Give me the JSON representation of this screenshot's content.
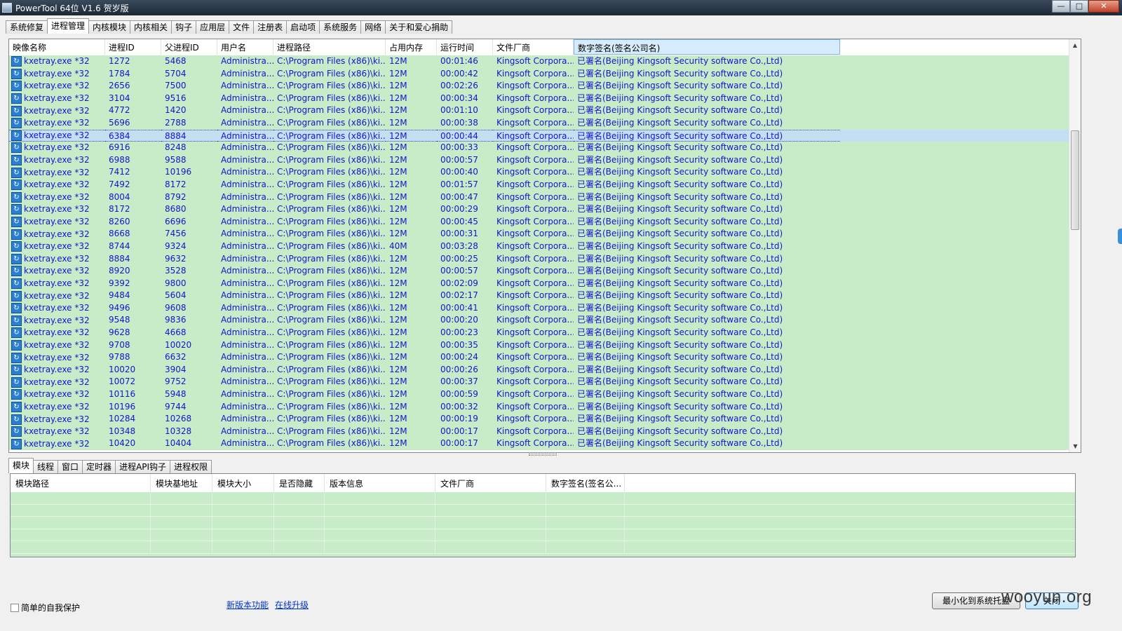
{
  "window": {
    "title": "PowerTool 64位 V1.6 贺岁版",
    "buttons": {
      "minimize": "—",
      "maximize": "□",
      "close": "✕"
    }
  },
  "main_tabs": [
    "系统修复",
    "进程管理",
    "内核模块",
    "内核相关",
    "钩子",
    "应用层",
    "文件",
    "注册表",
    "启动项",
    "系统服务",
    "网络",
    "关于和爱心捐助"
  ],
  "active_main_tab": "进程管理",
  "process_table": {
    "columns": [
      "映像名称",
      "进程ID",
      "父进程ID",
      "用户名",
      "进程路径",
      "占用内存",
      "运行时间",
      "文件厂商",
      "数字签名(签名公司名)"
    ],
    "common": {
      "name": "kxetray.exe *32",
      "user": "Administra...",
      "path": "C:\\Program Files (x86)\\ki...",
      "vendor": "Kingsoft Corpora...",
      "signature": "已署名(Beijing Kingsoft Security software Co.,Ltd)"
    },
    "rows": [
      {
        "pid": "1272",
        "ppid": "5468",
        "mem": "12M",
        "time": "00:01:46"
      },
      {
        "pid": "1784",
        "ppid": "5704",
        "mem": "12M",
        "time": "00:00:42"
      },
      {
        "pid": "2656",
        "ppid": "7500",
        "mem": "12M",
        "time": "00:02:26"
      },
      {
        "pid": "3104",
        "ppid": "9516",
        "mem": "12M",
        "time": "00:00:34"
      },
      {
        "pid": "4772",
        "ppid": "1420",
        "mem": "12M",
        "time": "00:01:10"
      },
      {
        "pid": "5696",
        "ppid": "2788",
        "mem": "12M",
        "time": "00:00:38"
      },
      {
        "pid": "6384",
        "ppid": "8884",
        "mem": "12M",
        "time": "00:00:44",
        "selected": true
      },
      {
        "pid": "6916",
        "ppid": "8248",
        "mem": "12M",
        "time": "00:00:33"
      },
      {
        "pid": "6988",
        "ppid": "9588",
        "mem": "12M",
        "time": "00:00:57"
      },
      {
        "pid": "7412",
        "ppid": "10196",
        "mem": "12M",
        "time": "00:00:40"
      },
      {
        "pid": "7492",
        "ppid": "8172",
        "mem": "12M",
        "time": "00:01:57"
      },
      {
        "pid": "8004",
        "ppid": "8792",
        "mem": "12M",
        "time": "00:00:47"
      },
      {
        "pid": "8172",
        "ppid": "8680",
        "mem": "12M",
        "time": "00:00:29"
      },
      {
        "pid": "8260",
        "ppid": "6696",
        "mem": "12M",
        "time": "00:00:45"
      },
      {
        "pid": "8668",
        "ppid": "7456",
        "mem": "12M",
        "time": "00:00:31"
      },
      {
        "pid": "8744",
        "ppid": "9324",
        "mem": "40M",
        "time": "00:03:28"
      },
      {
        "pid": "8884",
        "ppid": "9632",
        "mem": "12M",
        "time": "00:00:25"
      },
      {
        "pid": "8920",
        "ppid": "3528",
        "mem": "12M",
        "time": "00:00:57"
      },
      {
        "pid": "9392",
        "ppid": "9800",
        "mem": "12M",
        "time": "00:02:09"
      },
      {
        "pid": "9484",
        "ppid": "5604",
        "mem": "12M",
        "time": "00:02:17"
      },
      {
        "pid": "9496",
        "ppid": "9608",
        "mem": "12M",
        "time": "00:00:41"
      },
      {
        "pid": "9548",
        "ppid": "9836",
        "mem": "12M",
        "time": "00:00:20"
      },
      {
        "pid": "9628",
        "ppid": "4668",
        "mem": "12M",
        "time": "00:00:23"
      },
      {
        "pid": "9708",
        "ppid": "10020",
        "mem": "12M",
        "time": "00:00:35"
      },
      {
        "pid": "9788",
        "ppid": "6632",
        "mem": "12M",
        "time": "00:00:24"
      },
      {
        "pid": "10020",
        "ppid": "3904",
        "mem": "12M",
        "time": "00:00:26"
      },
      {
        "pid": "10072",
        "ppid": "9752",
        "mem": "12M",
        "time": "00:00:37"
      },
      {
        "pid": "10116",
        "ppid": "5948",
        "mem": "12M",
        "time": "00:00:59"
      },
      {
        "pid": "10196",
        "ppid": "9744",
        "mem": "12M",
        "time": "00:00:32"
      },
      {
        "pid": "10284",
        "ppid": "10268",
        "mem": "12M",
        "time": "00:00:19"
      },
      {
        "pid": "10348",
        "ppid": "10328",
        "mem": "12M",
        "time": "00:00:17"
      },
      {
        "pid": "10420",
        "ppid": "10404",
        "mem": "12M",
        "time": "00:00:17"
      }
    ]
  },
  "sub_tabs": [
    "模块",
    "线程",
    "窗口",
    "定时器",
    "进程API钩子",
    "进程权限"
  ],
  "active_sub_tab": "模块",
  "module_table": {
    "columns": [
      "模块路径",
      "模块基地址",
      "模块大小",
      "是否隐藏",
      "版本信息",
      "文件厂商",
      "数字签名(签名公..."
    ]
  },
  "footer": {
    "self_protect_label": "简单的自我保护",
    "new_features_link": "新版本功能",
    "online_update_link": "在线升级",
    "minimize_tray_button": "最小化到系统托盘",
    "close_button": "关闭",
    "watermark": "wooyun.org"
  },
  "colors": {
    "row_bg": "#c8ecc8",
    "row_text": "#1414d2",
    "selected_row_bg": "#c4dff2"
  }
}
